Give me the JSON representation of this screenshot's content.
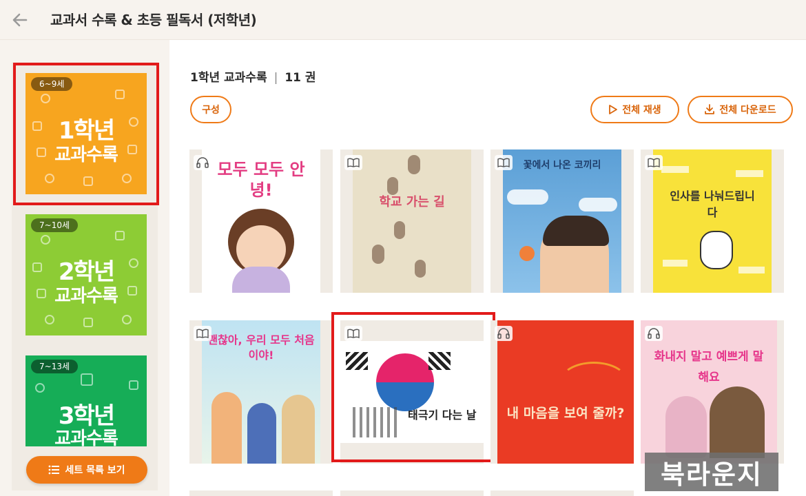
{
  "header": {
    "back_icon": "arrow-left-icon",
    "title": "교과서 수록 & 초등 필독서 (저학년)"
  },
  "sidebar": {
    "sets": [
      {
        "age": "6~9세",
        "line1": "1학년",
        "line2": "교과수록",
        "color": "#f7a51f",
        "selected": true
      },
      {
        "age": "7~10세",
        "line1": "2학년",
        "line2": "교과수록",
        "color": "#8dcc35",
        "selected": false
      },
      {
        "age": "7~13세",
        "line1": "3학년",
        "line2": "교과수록",
        "color": "#16ad57",
        "selected": false
      }
    ],
    "set_list_button": "세트 목록 보기",
    "set_list_icon": "list-icon"
  },
  "main": {
    "section_title": "1학년 교과수록",
    "separator": "|",
    "count": "11 권",
    "compose_button": "구성",
    "play_all_button": "전체 재생",
    "download_all_button": "전체 다운로드"
  },
  "books": [
    {
      "title": "모두 모두 안녕!",
      "badge": "headphones-icon"
    },
    {
      "title": "학교 가는 길",
      "badge": "book-icon"
    },
    {
      "title": "꽃에서 나온 코끼리",
      "badge": "book-icon"
    },
    {
      "title": "인사를 나눠드립니다",
      "badge": "book-icon"
    },
    {
      "title": "괜찮아, 우리 모두 처음이야!",
      "badge": "book-icon"
    },
    {
      "title": "태극기 다는 날",
      "badge": "book-icon"
    },
    {
      "title": "내 마음을 보여 줄까?",
      "badge": "headphones-icon"
    },
    {
      "title": "화내지 말고 예쁘게 말해요",
      "badge": "headphones-icon"
    }
  ],
  "watermark": "북라운지",
  "colors": {
    "accent": "#ef7a17",
    "highlight": "#e21a1a"
  }
}
